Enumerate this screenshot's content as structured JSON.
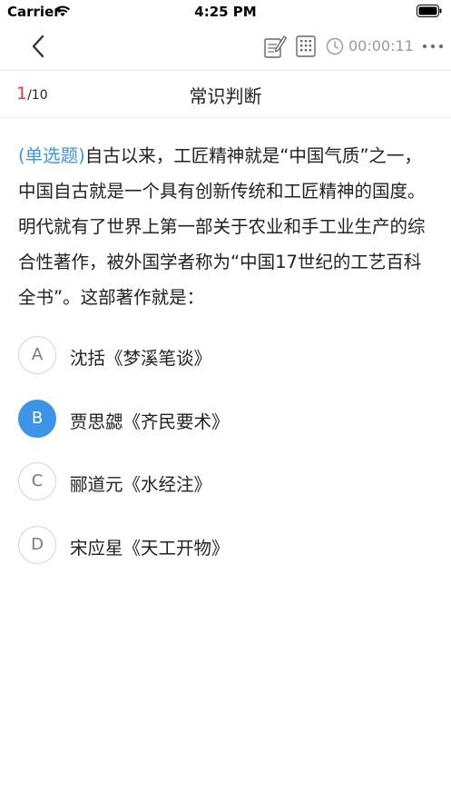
{
  "status_bar": {
    "carrier": "Carrier",
    "time": "4:25 PM"
  },
  "nav": {
    "timer": "00:00:11"
  },
  "header": {
    "current": "1",
    "total": "/10",
    "title": "常识判断"
  },
  "question": {
    "type": "(单选题)",
    "text": "自古以来，工匠精神就是“中国气质”之一，中国自古就是一个具有创新传统和工匠精神的国度。明代就有了世界上第一部关于农业和手工业生产的综合性著作，被外国学者称为“中国17世纪的工艺百科全书”。这部著作就是："
  },
  "options": [
    {
      "letter": "A",
      "text": "沈括《梦溪笔谈》",
      "selected": false
    },
    {
      "letter": "B",
      "text": "贾思勰《齐民要术》",
      "selected": true
    },
    {
      "letter": "C",
      "text": "郦道元《水经注》",
      "selected": false
    },
    {
      "letter": "D",
      "text": "宋应星《天工开物》",
      "selected": false
    }
  ],
  "colors": {
    "accent": "#3d94e6",
    "progress_current": "#e53935"
  }
}
